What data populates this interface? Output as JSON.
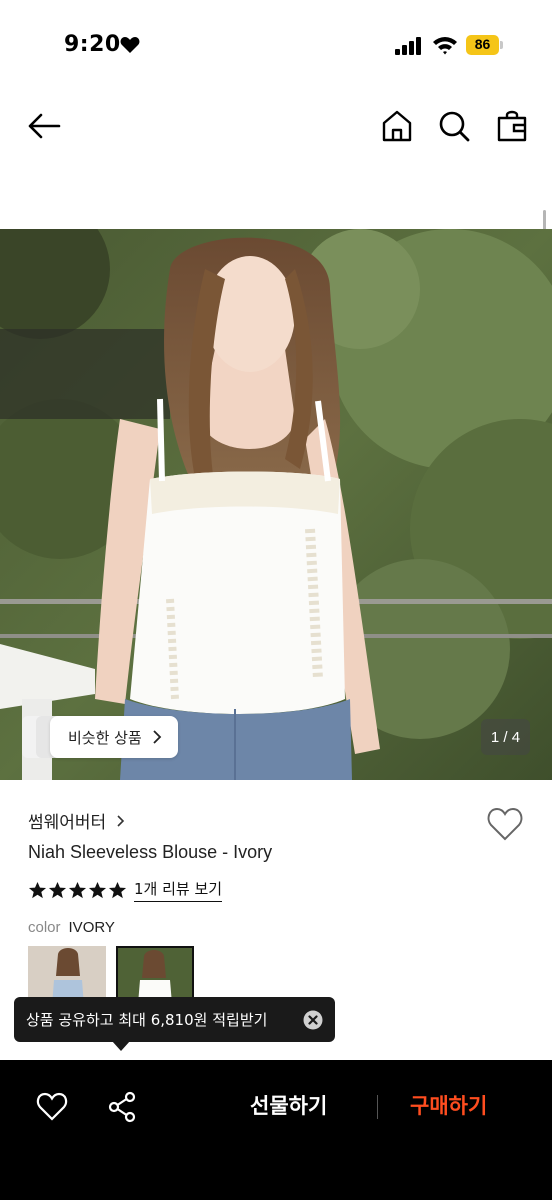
{
  "status_bar": {
    "time": "9:20",
    "battery": "86",
    "icons": [
      "heart-icon",
      "signal-icon",
      "wifi-icon",
      "battery-icon"
    ]
  },
  "nav": {
    "icons": [
      "back-arrow-icon",
      "home-icon",
      "search-icon",
      "shopping-bag-icon"
    ]
  },
  "hero": {
    "similar_label": "비슷한 상품",
    "counter": "1 / 4"
  },
  "product": {
    "brand": "썸웨어버터",
    "name": "Niah Sleeveless Blouse - Ivory",
    "rating_stars": 5,
    "review_link": "1개 리뷰 보기",
    "color_key": "color",
    "color_value": "IVORY"
  },
  "toast": {
    "text": "상품 공유하고 최대 6,810원 적립받기"
  },
  "bottom_bar": {
    "gift_label": "선물하기",
    "buy_label": "구매하기"
  },
  "colors": {
    "accent_buy": "#ff4d1f",
    "battery": "#f5c518",
    "bottom_bg": "#000000"
  }
}
